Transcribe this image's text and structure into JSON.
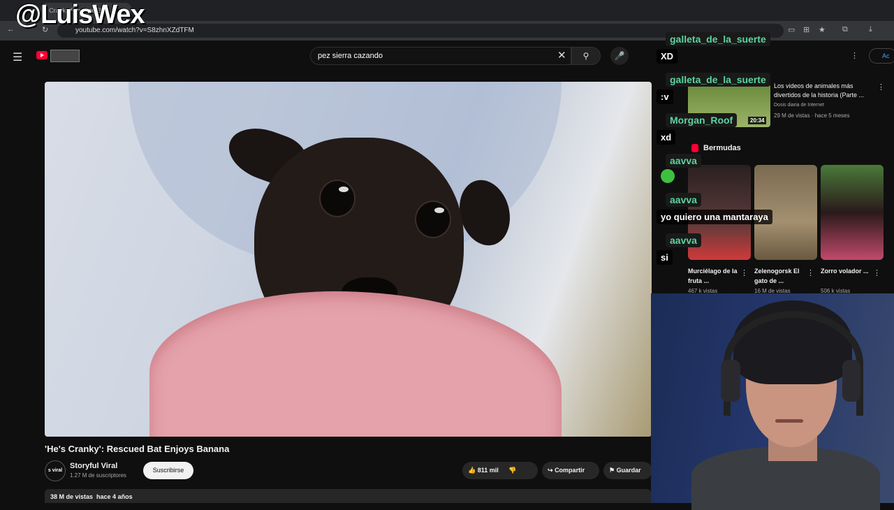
{
  "watermark": "@LuisWex",
  "browser": {
    "tab_title": "Cranky Rescued Bat",
    "url": "youtube.com/watch?v=S8zhnXZdTFM"
  },
  "header": {
    "search_query": "pez sierra cazando",
    "user_label": "Ac"
  },
  "video": {
    "title": "'He's Cranky': Rescued Bat Enjoys Banana",
    "channel": {
      "avatar_text": "s viral",
      "name": "Storyful Viral",
      "subscribers": "1.27 M de suscriptores",
      "subscribe_label": "Suscribirse"
    },
    "likes": "811 mil",
    "share_label": "Compartir",
    "save_label": "Guardar",
    "views": "38 M de vistas",
    "age": "hace 4 años"
  },
  "sidebar": {
    "video": {
      "title": "Los videos de animales más divertidos de la historia (Parte ...",
      "channel": "Dosis diaria de Internet",
      "meta": "29 M de vistas · hace 5 meses",
      "duration": "20:34"
    },
    "shorts_label": "Bermudas",
    "shorts": [
      {
        "title": "Murciélago de la fruta ...",
        "views": "467 k vistas"
      },
      {
        "title": "Zelenogorsk El gato de ...",
        "views": "16 M de vistas"
      },
      {
        "title": "Zorro volador ...",
        "views": "506 k vistas"
      }
    ]
  },
  "chat": [
    {
      "user": "galleta_de_la_suerte",
      "msg": "XD"
    },
    {
      "user": "galleta_de_la_suerte",
      "msg": ":v"
    },
    {
      "user": "Morgan_Roof",
      "msg": "xd"
    },
    {
      "user": "aavva",
      "msg": ""
    },
    {
      "user": "aavva",
      "msg": "yo quiero una mantaraya"
    },
    {
      "user": "aavva",
      "msg": "si"
    }
  ],
  "colors": {
    "accent_red": "#ff0033",
    "chat_name": "#5dd39e",
    "background": "#0f0f0f"
  }
}
